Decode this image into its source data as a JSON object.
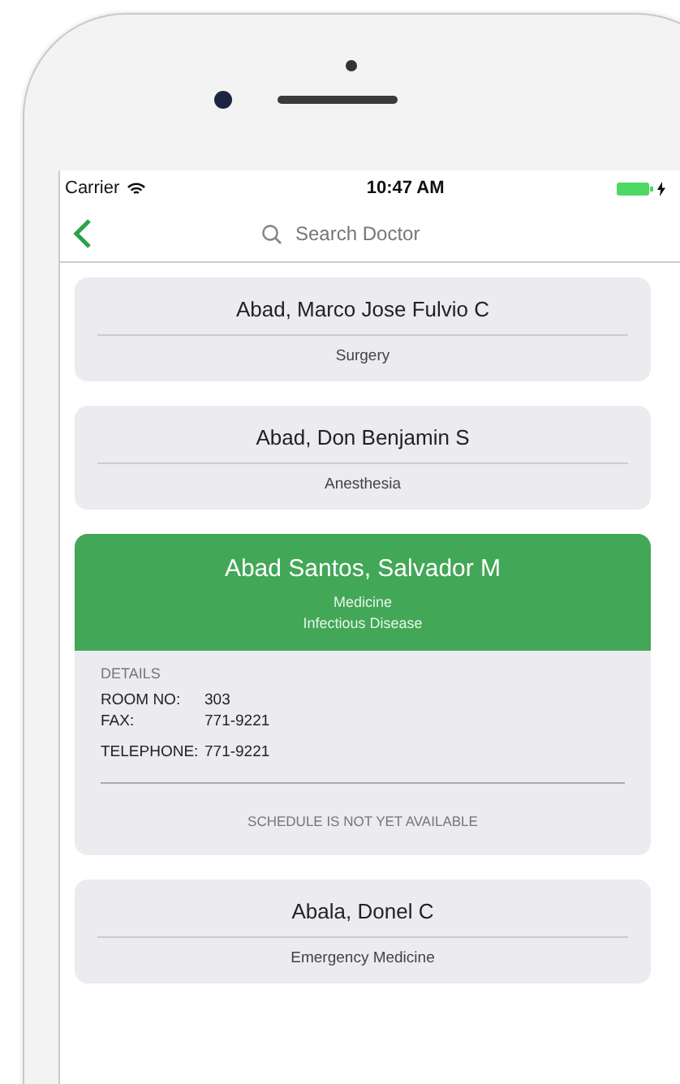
{
  "status_bar": {
    "carrier": "Carrier",
    "time": "10:47 AM",
    "charging": true
  },
  "nav": {
    "search": {
      "placeholder": "Search Doctor"
    }
  },
  "doctors": [
    {
      "name": "Abad, Marco Jose Fulvio C",
      "departments": [
        "Surgery"
      ],
      "expanded": false
    },
    {
      "name": "Abad, Don Benjamin S",
      "departments": [
        "Anesthesia"
      ],
      "expanded": false
    },
    {
      "name": "Abad Santos, Salvador M",
      "departments": [
        "Medicine",
        "Infectious Disease"
      ],
      "expanded": true,
      "details": {
        "heading": "DETAILS",
        "fields": [
          {
            "label": "ROOM NO:",
            "value": "303"
          },
          {
            "label": "FAX:",
            "value": "771-9221"
          },
          {
            "label": "TELEPHONE:",
            "value": "771-9221"
          }
        ],
        "schedule": "SCHEDULE IS NOT YET AVAILABLE"
      }
    },
    {
      "name": "Abala, Donel C",
      "departments": [
        "Emergency Medicine"
      ],
      "expanded": false
    }
  ]
}
